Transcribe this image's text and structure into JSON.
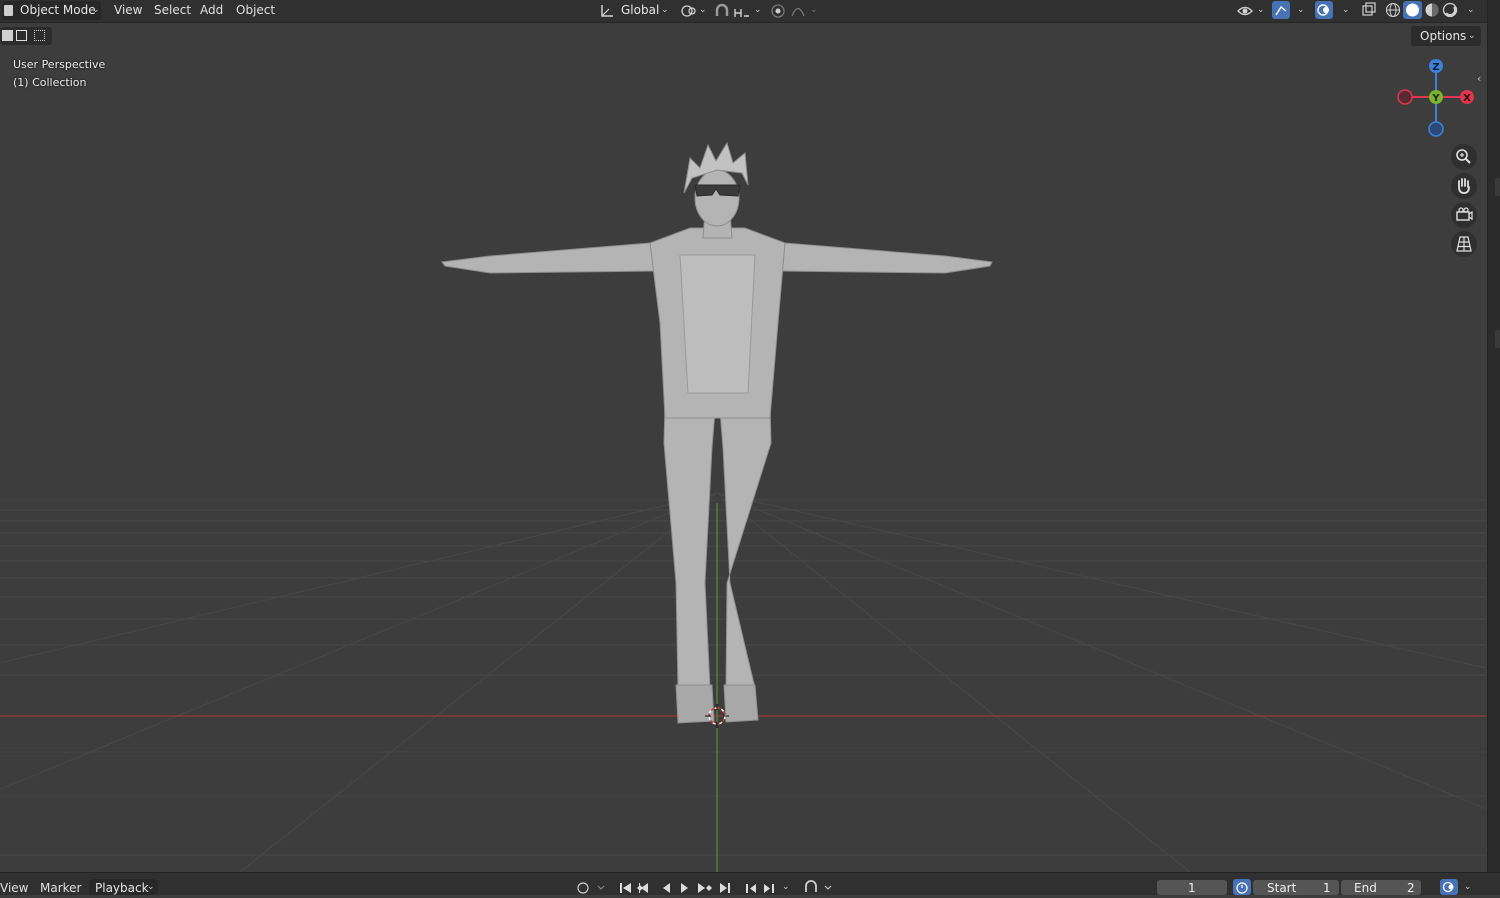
{
  "header": {
    "mode_label": "Object Mode",
    "menus": [
      "View",
      "Select",
      "Add",
      "Object"
    ],
    "orientation_label": "Global",
    "options_label": "Options"
  },
  "viewport": {
    "info_line1": "User Perspective",
    "info_line2": "(1) Collection",
    "gizmo": {
      "x_label": "X",
      "y_label": "Y",
      "z_label": "Z"
    },
    "colors": {
      "x_axis": "#e0374f",
      "y_axis": "#7ab32e",
      "z_axis": "#3c82db",
      "background": "#3d3d3d"
    }
  },
  "timeline": {
    "menus": [
      "View",
      "Marker",
      "Playback"
    ],
    "current_frame": "1",
    "start_label": "Start",
    "start_value": "1",
    "end_label": "End",
    "end_value": "2"
  }
}
